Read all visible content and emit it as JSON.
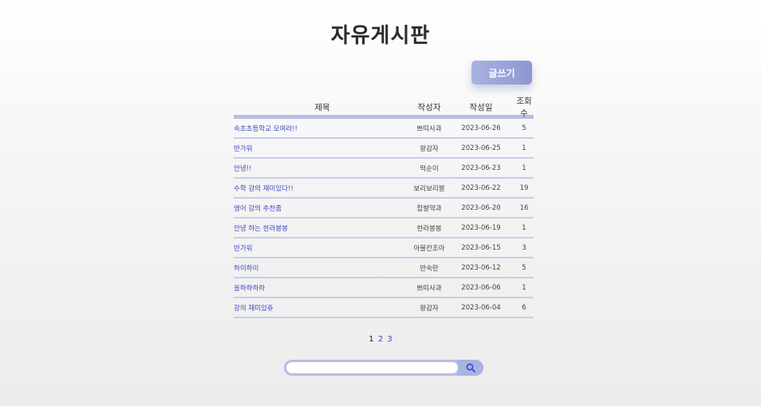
{
  "page_title": "자유게시판",
  "write_button": "글쓰기",
  "table": {
    "headers": {
      "title": "제목",
      "author": "작성자",
      "date": "작성일",
      "views": "조회수"
    },
    "rows": [
      {
        "title": "속초초등학교 모여라!!",
        "author": "쁘띠사과",
        "date": "2023-06-26",
        "views": "5"
      },
      {
        "title": "반가워",
        "author": "왕감자",
        "date": "2023-06-25",
        "views": "1"
      },
      {
        "title": "안녕!!",
        "author": "떡순이",
        "date": "2023-06-23",
        "views": "1"
      },
      {
        "title": "수학 강의 재미있다!!",
        "author": "보리보리쌀",
        "date": "2023-06-22",
        "views": "19"
      },
      {
        "title": "영어 강의 추천좀",
        "author": "찹쌀약과",
        "date": "2023-06-20",
        "views": "16"
      },
      {
        "title": "안녕 하는 한라봉봉",
        "author": "한라봉봉",
        "date": "2023-06-19",
        "views": "1"
      },
      {
        "title": "반가워",
        "author": "아불칸조아",
        "date": "2023-06-15",
        "views": "3"
      },
      {
        "title": "하이하이",
        "author": "반숙란",
        "date": "2023-06-12",
        "views": "5"
      },
      {
        "title": "올하하하하",
        "author": "쁘띠사과",
        "date": "2023-06-06",
        "views": "1"
      },
      {
        "title": "강의 재미있쥬",
        "author": "왕감자",
        "date": "2023-06-04",
        "views": "6"
      }
    ]
  },
  "pagination": {
    "current": "1",
    "pages": [
      "2",
      "3"
    ]
  },
  "search": {
    "value": "",
    "placeholder": "",
    "icon": "search-icon"
  },
  "colors": {
    "accent": "#8c97d1",
    "link": "#3b48c4",
    "divider": "#b7bde6"
  }
}
